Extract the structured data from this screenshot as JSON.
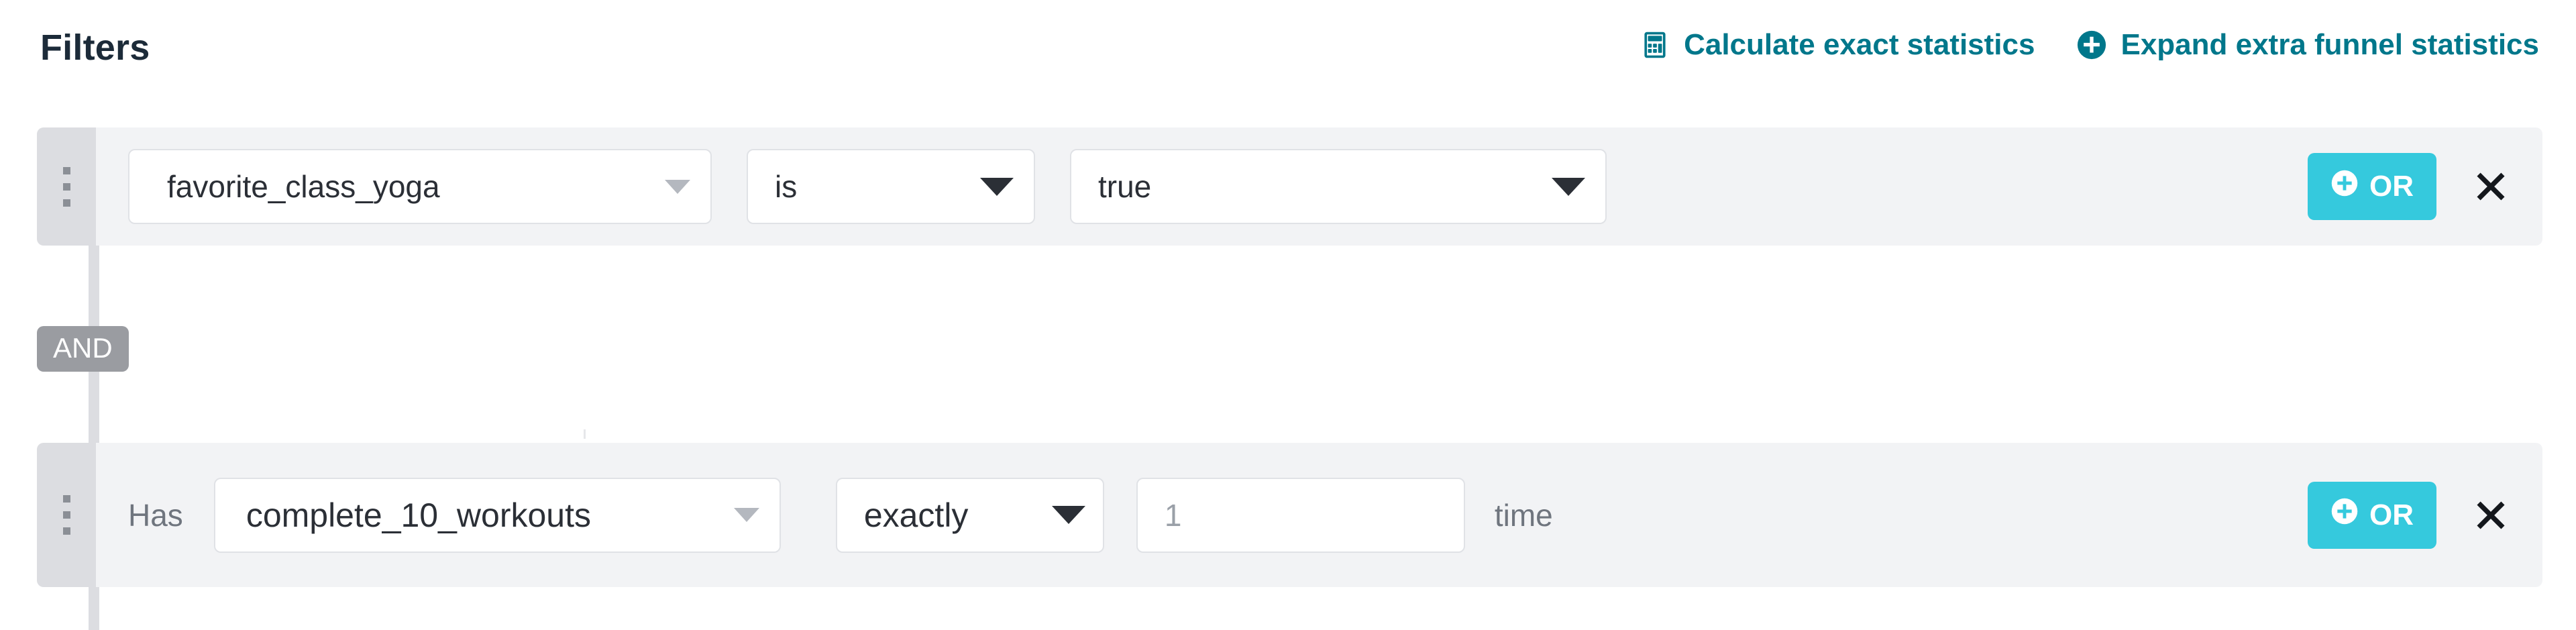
{
  "header": {
    "title": "Filters",
    "actions": [
      {
        "label": "Calculate exact statistics",
        "icon": "calculator-icon"
      },
      {
        "label": "Expand extra funnel statistics",
        "icon": "circle-plus-icon"
      }
    ],
    "accent_color": "#00778b"
  },
  "colors": {
    "accent_teal": "#00778b",
    "or_button_cyan": "#35c9dd",
    "row_background": "#f2f3f5",
    "handle_background": "#dcdde1",
    "and_badge_gray": "#9a9ca1",
    "title_color": "#1c2b39"
  },
  "connector": {
    "operator_badge": "AND"
  },
  "rows": [
    {
      "handle": "drag-handle",
      "property": {
        "value": "favorite_class_yoga"
      },
      "operator": {
        "value": "is"
      },
      "value": {
        "value": "true"
      },
      "or_label": "OR",
      "remove_label": "×"
    },
    {
      "handle": "drag-handle",
      "prefix": "Has",
      "event": {
        "value": "complete_10_workouts"
      },
      "count_operator": {
        "value": "exactly"
      },
      "count": {
        "value": "1",
        "placeholder": "1"
      },
      "unit": "time",
      "or_label": "OR",
      "remove_label": "×"
    }
  ]
}
